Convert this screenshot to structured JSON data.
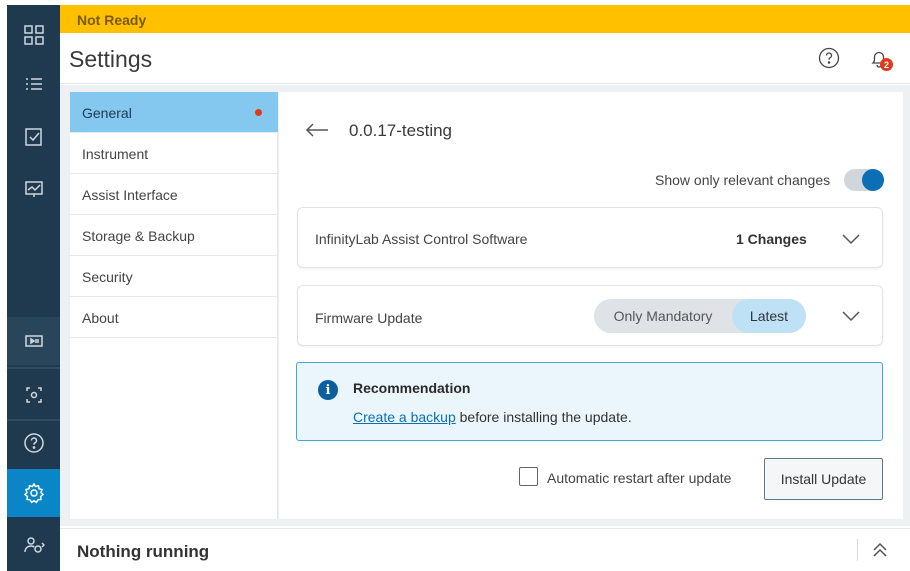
{
  "status_banner": {
    "text": "Not Ready",
    "color": "#ffc000"
  },
  "header": {
    "title": "Settings",
    "help_icon": "help-circle-icon",
    "notification_icon": "bell-icon",
    "notification_count": "2"
  },
  "rail": {
    "items": [
      {
        "icon": "dashboard-grid-icon"
      },
      {
        "icon": "list-icon"
      },
      {
        "icon": "checklist-icon"
      },
      {
        "icon": "monitor-chart-icon"
      },
      {
        "icon": "play-pause-icon"
      },
      {
        "icon": "camera-focus-icon"
      },
      {
        "icon": "help-icon"
      },
      {
        "icon": "settings-gear-icon",
        "active": true
      },
      {
        "icon": "user-settings-icon"
      }
    ]
  },
  "settings_nav": {
    "items": [
      {
        "label": "General",
        "active": true,
        "dot": true
      },
      {
        "label": "Instrument"
      },
      {
        "label": "Assist Interface"
      },
      {
        "label": "Storage & Backup"
      },
      {
        "label": "Security"
      },
      {
        "label": "About"
      }
    ]
  },
  "main": {
    "version": "0.0.17-testing",
    "toggle": {
      "label": "Show only relevant changes",
      "on": true
    },
    "software_card": {
      "label": "InfinityLab Assist Control Software",
      "changes": "1 Changes"
    },
    "firmware_card": {
      "label": "Firmware Update",
      "options": [
        "Only Mandatory",
        "Latest"
      ],
      "selected": "Latest"
    },
    "recommendation": {
      "title": "Recommendation",
      "link_text": "Create a backup",
      "body_text": " before installing the update."
    },
    "auto_restart_label": "Automatic restart after update",
    "install_button": "Install Update"
  },
  "bottom_bar": {
    "text": "Nothing running"
  }
}
